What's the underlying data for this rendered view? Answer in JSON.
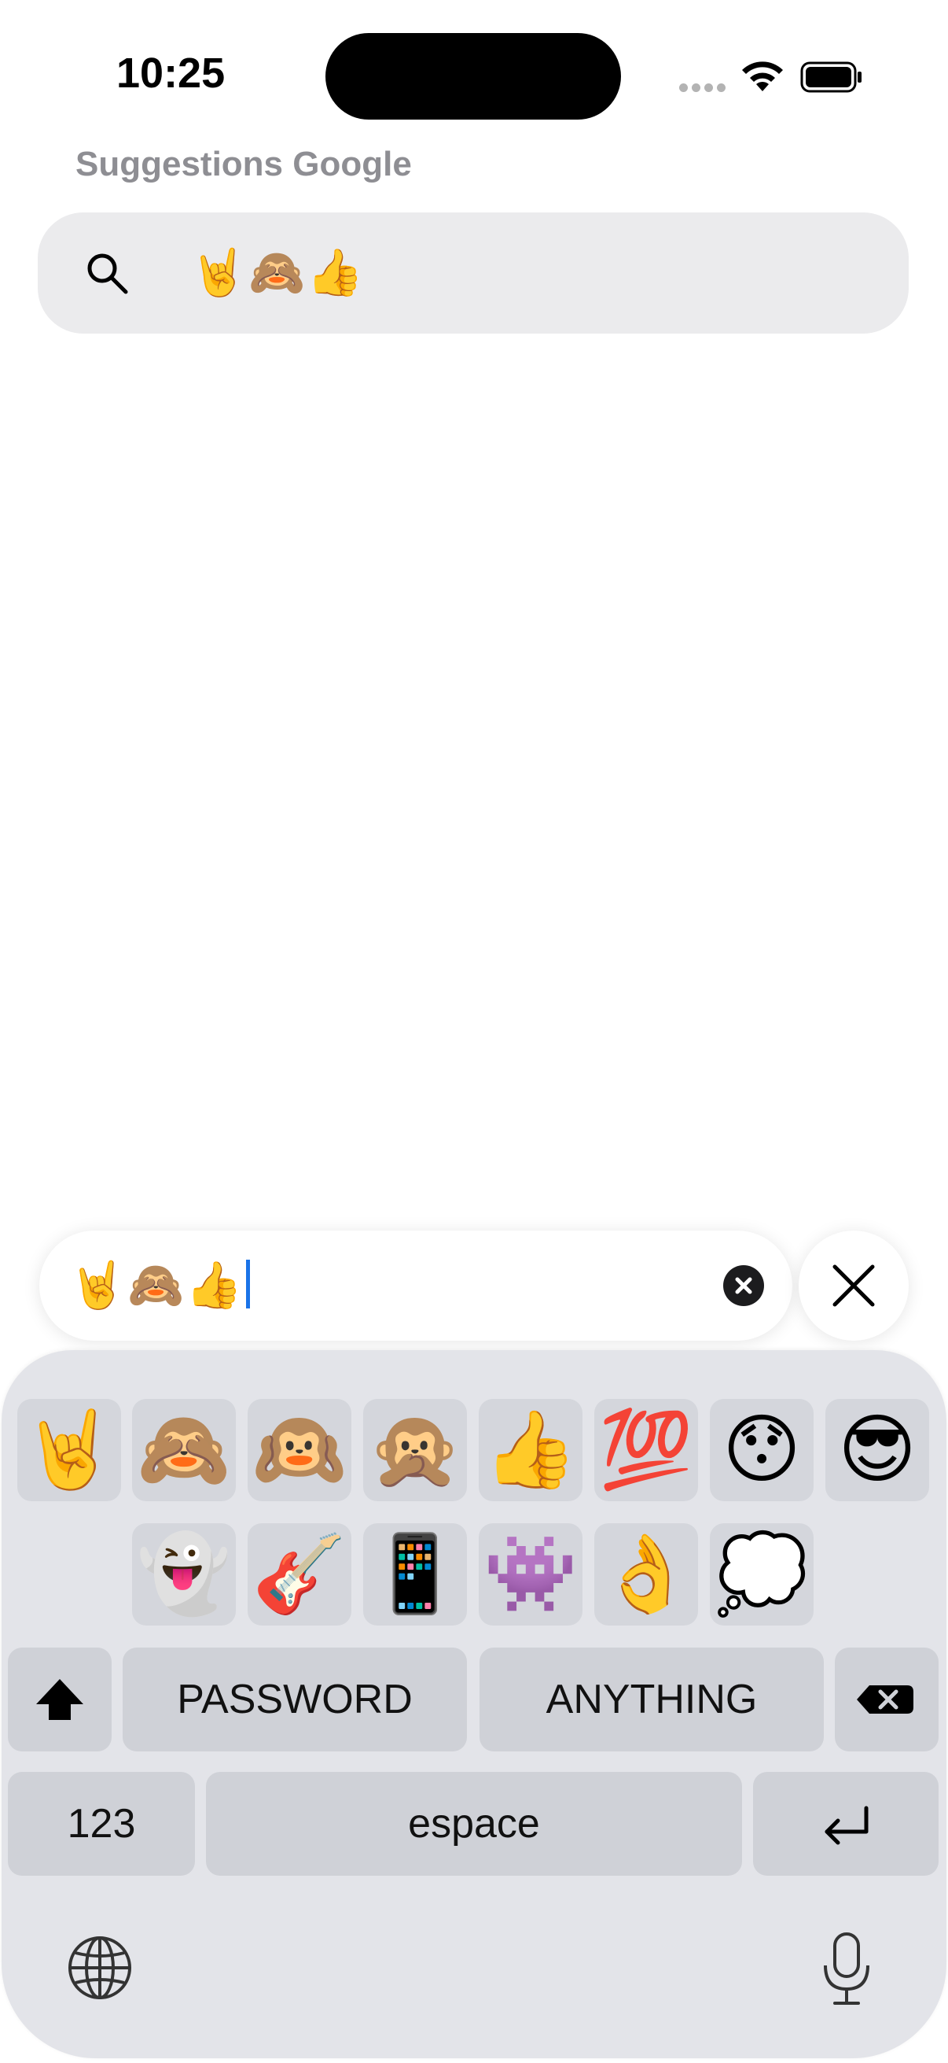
{
  "status_bar": {
    "time": "10:25"
  },
  "header": {
    "section_label": "Suggestions Google",
    "search_query": "🤘🙈👍"
  },
  "compose": {
    "text": "🤘🙈👍"
  },
  "keyboard": {
    "emoji_row_1": [
      "🤘",
      "🙈",
      "🙉",
      "🙊",
      "👍",
      "💯",
      "😯",
      "😎"
    ],
    "emoji_row_2": [
      "👻",
      "🎸",
      "📱",
      "👾",
      "👌",
      "💭"
    ],
    "suggestions": [
      "PASSWORD",
      "ANYTHING"
    ],
    "numbers_label": "123",
    "space_label": "espace"
  },
  "colors": {
    "accent_caret": "#1a73e8",
    "keyboard_bg": "#e3e4e9",
    "key_bg": "#cfd1d7",
    "search_bg": "#ebebed",
    "label_gray": "#8e8e93"
  },
  "icons": {
    "search": "search-icon",
    "clear": "clear-circle-icon",
    "close": "close-icon",
    "shift": "shift-icon",
    "delete": "backspace-icon",
    "return": "return-icon",
    "globe": "globe-icon",
    "mic": "microphone-icon",
    "wifi": "wifi-icon",
    "battery": "battery-icon"
  }
}
